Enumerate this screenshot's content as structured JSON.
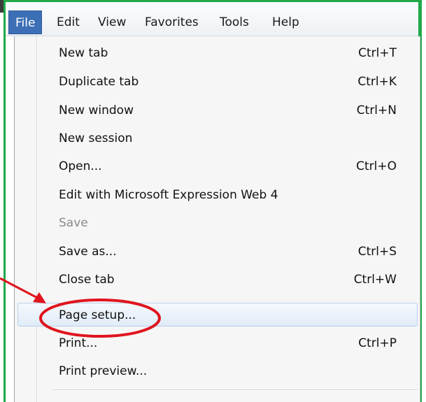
{
  "menubar": {
    "items": [
      {
        "label": "File",
        "active": true
      },
      {
        "label": "Edit",
        "active": false
      },
      {
        "label": "View",
        "active": false
      },
      {
        "label": "Favorites",
        "active": false
      },
      {
        "label": "Tools",
        "active": false
      },
      {
        "label": "Help",
        "active": false
      }
    ]
  },
  "file_menu": {
    "items": [
      {
        "label": "New tab",
        "shortcut": "Ctrl+T",
        "enabled": true
      },
      {
        "label": "Duplicate tab",
        "shortcut": "Ctrl+K",
        "enabled": true
      },
      {
        "label": "New window",
        "shortcut": "Ctrl+N",
        "enabled": true
      },
      {
        "label": "New session",
        "shortcut": "",
        "enabled": true
      },
      {
        "label": "Open...",
        "shortcut": "Ctrl+O",
        "enabled": true
      },
      {
        "label": "Edit with Microsoft Expression Web 4",
        "shortcut": "",
        "enabled": true
      },
      {
        "label": "Save",
        "shortcut": "",
        "enabled": false
      },
      {
        "label": "Save as...",
        "shortcut": "Ctrl+S",
        "enabled": true
      },
      {
        "label": "Close tab",
        "shortcut": "Ctrl+W",
        "enabled": true
      },
      {
        "label": "Page setup...",
        "shortcut": "",
        "enabled": true,
        "highlighted": true
      },
      {
        "label": "Print...",
        "shortcut": "Ctrl+P",
        "enabled": true
      },
      {
        "label": "Print preview...",
        "shortcut": "",
        "enabled": true
      }
    ]
  },
  "colors": {
    "frame": "#22a84a",
    "menu_active": "#3c6fb5",
    "annotation": "#e0141e",
    "highlight_border": "#b7d0ec"
  }
}
